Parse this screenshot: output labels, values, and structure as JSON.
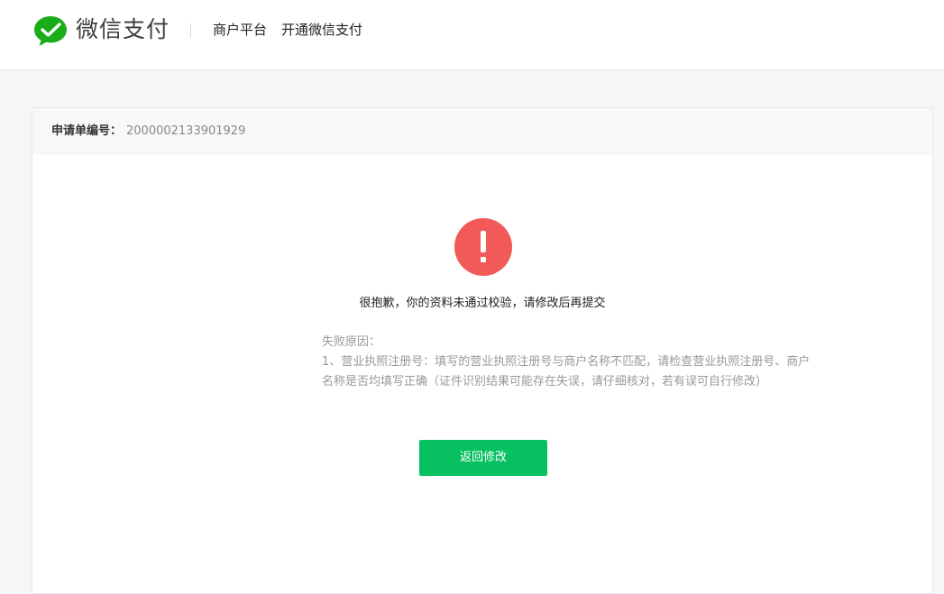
{
  "header": {
    "brand_name": "微信支付",
    "nav": {
      "merchant_platform": "商户平台",
      "open_wechat_pay": "开通微信支付"
    },
    "brand_color": "#1aad19",
    "logo_icon": "wechat-pay-check-icon"
  },
  "application": {
    "number_label": "申请单编号：",
    "number_value": "2000002133901929"
  },
  "result": {
    "status_icon": "exclamation-circle-icon",
    "status_color": "#f15a59",
    "message": "很抱歉，你的资料未通过校验，请修改后再提交",
    "reason_title": "失败原因：",
    "reason_text": "1、营业执照注册号：填写的营业执照注册号与商户名称不匹配，请检查营业执照注册号、商户名称是否均填写正确（证件识别结果可能存在失误，请仔细核对，若有误可自行修改）"
  },
  "actions": {
    "back_label": "返回修改",
    "button_color": "#07c160"
  }
}
